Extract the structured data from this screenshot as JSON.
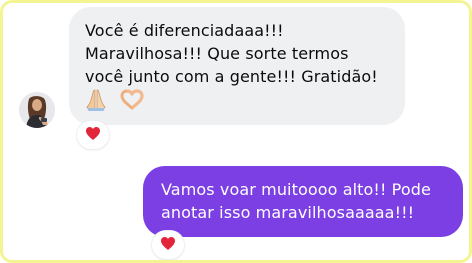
{
  "incoming_message": {
    "lines": [
      "Você é diferenciadaaa!!!",
      "Maravilhosa!!! Que sorte termos",
      "você junto com a gente!!! Gratidão!"
    ],
    "emojis": [
      "praying-hands-emoji",
      "heart-hands-emoji"
    ],
    "reaction": "red-heart-emoji",
    "bubble_color": "#eef0f2"
  },
  "outgoing_message": {
    "lines": [
      "Vamos voar muitoooo alto!! Pode",
      "anotar isso maravilhosaaaaa!!!"
    ],
    "reaction": "red-heart-emoji",
    "bubble_color": "#7b3fe4"
  },
  "colors": {
    "frame_border": "#f4f493",
    "heart": "#e2253a"
  }
}
